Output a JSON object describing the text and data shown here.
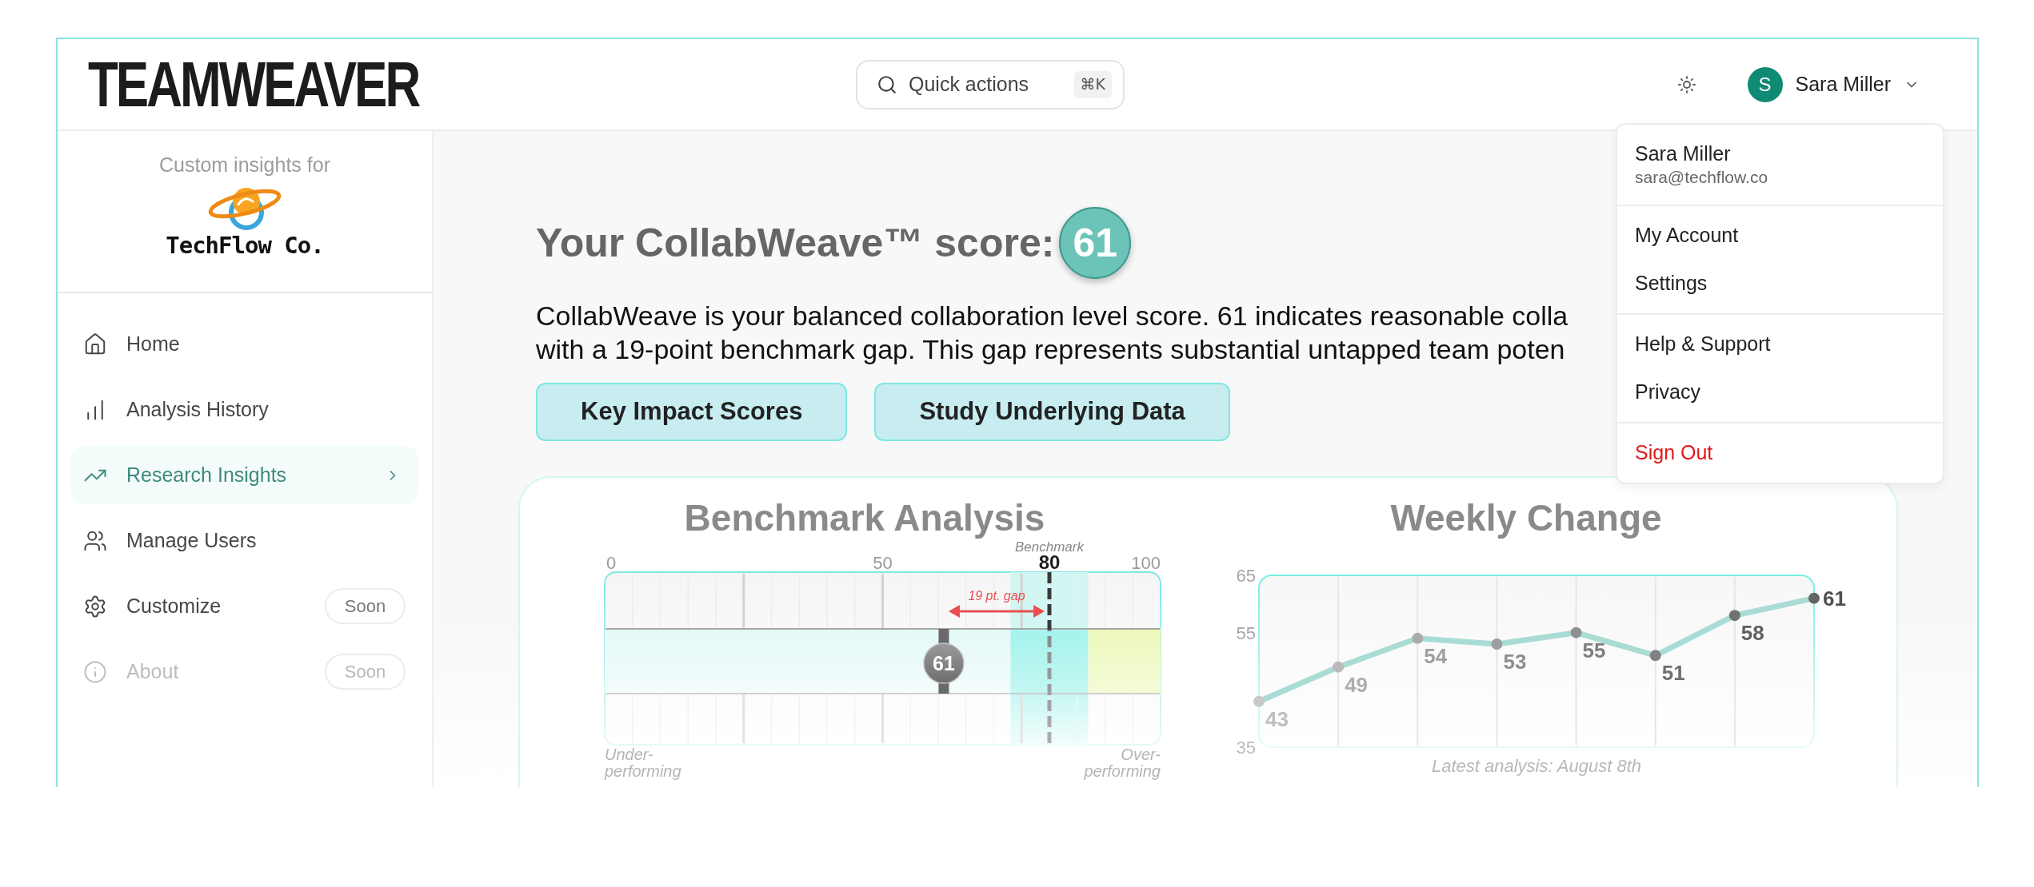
{
  "header": {
    "logo": "TEAMWEAVER",
    "quick_actions": {
      "label": "Quick actions",
      "shortcut": "⌘K"
    },
    "user": {
      "initial": "S",
      "name": "Sara Miller"
    }
  },
  "user_menu": {
    "expanded": true,
    "name": "Sara Miller",
    "email": "sara@techflow.co",
    "sections": [
      {
        "items": [
          {
            "label": "My Account",
            "kind": "normal"
          },
          {
            "label": "Settings",
            "kind": "normal"
          }
        ]
      },
      {
        "items": [
          {
            "label": "Help & Support",
            "kind": "normal"
          },
          {
            "label": "Privacy",
            "kind": "normal"
          }
        ]
      },
      {
        "items": [
          {
            "label": "Sign Out",
            "kind": "danger"
          }
        ]
      }
    ]
  },
  "sidebar": {
    "caption": "Custom insights for",
    "client_name": "TechFlow Co.",
    "items": [
      {
        "label": "Home",
        "selected": false,
        "disabled": false
      },
      {
        "label": "Analysis History",
        "selected": false,
        "disabled": false
      },
      {
        "label": "Research Insights",
        "selected": true,
        "disabled": false
      },
      {
        "label": "Manage Users",
        "selected": false,
        "disabled": false
      },
      {
        "label": "Customize",
        "selected": false,
        "disabled": false,
        "badge": "Soon"
      },
      {
        "label": "About",
        "selected": false,
        "disabled": true,
        "badge": "Soon"
      }
    ]
  },
  "main": {
    "heading": "Your CollabWeave™ score:",
    "score": "61",
    "description_lines": [
      "CollabWeave is your balanced collaboration level score. 61 indicates reasonable colla",
      "with a 19-point benchmark gap. This gap represents substantial untapped team poten"
    ],
    "buttons": [
      "Key Impact Scores",
      "Study Underlying Data"
    ]
  },
  "benchmark_analysis": {
    "title": "Benchmark Analysis",
    "scale_labels": [
      "0",
      "50",
      "100"
    ],
    "benchmark": {
      "label": "Benchmark",
      "value": "80",
      "level": 0.8
    },
    "score": {
      "value": "61",
      "level": 0.61
    },
    "gap_label": "19 pt. gap",
    "zones": [
      {
        "kind": "under",
        "level": 0.73
      },
      {
        "kind": "target",
        "level": 0.87
      },
      {
        "kind": "over",
        "level": 1
      }
    ],
    "end_labels": [
      "Under-performing",
      "Over-performing"
    ]
  },
  "weekly_change": {
    "chart_data": {
      "type": "line",
      "title": "Weekly Change",
      "categories": [
        null,
        null,
        null,
        null,
        null,
        null,
        null,
        null
      ],
      "series": [
        {
          "color": "#a9dcd5",
          "marker": "circle",
          "values": [
            43,
            49,
            54,
            53,
            55,
            51,
            58,
            61
          ]
        }
      ],
      "ylim": [
        35,
        65
      ],
      "yticks": [
        35,
        55,
        65
      ],
      "grid": true,
      "data_labels": true
    },
    "caption": "Latest analysis: August 8th"
  }
}
